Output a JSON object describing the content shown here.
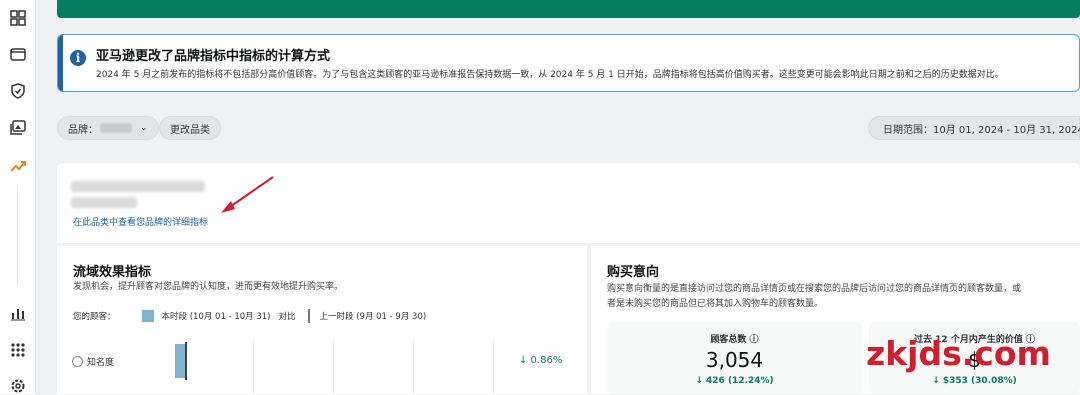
{
  "sidebar": {
    "icons": [
      "dashboard-icon",
      "wallet-icon",
      "shield-icon",
      "media-icon",
      "trend-icon",
      "bar-chart-icon",
      "apps-icon",
      "settings-icon"
    ]
  },
  "alert": {
    "title": "亚马逊更改了品牌指标中指标的计算方式",
    "text": "2024 年 5 月之前发布的指标将不包括部分高价值顾客。为了与包含这类顾客的亚马逊标准报告保持数据一致，从 2024 年 5 月 1 日开始，品牌指标将包括高价值购买者。这些变更可能会影响此日期之前和之后的历史数据对比。"
  },
  "filters": {
    "brand_label": "品牌：",
    "change_category": "更改品类",
    "date_range": "日期范围：10月 01, 2024 - 10月 31, 2024"
  },
  "brand": {
    "link": "在此品类中查看您品牌的详细指标"
  },
  "traffic": {
    "title": "流域效果指标",
    "desc": "发现机会，提升顾客对您品牌的认知度，进而更有效地提升购买率。",
    "legend_prefix": "您的顾客：",
    "current": "本时段 (10月 01 - 10月 31)",
    "compare": "对比",
    "previous": "上一时段 (9月 01 - 9月 30)",
    "row_label": "知名度",
    "row_delta": "↓ 0.86%"
  },
  "purchase": {
    "title": "购买意向",
    "desc_line1": "购买意向衡量的是直接访问过您的商品详情页或在搜索您的品牌后访问过您的商品详情页的顾客数量，或",
    "desc_line2": "者是未购买您的商品但已将其加入购物车的顾客数量。",
    "card1": {
      "label": "顾客总数 ⓘ",
      "value": "3,054",
      "delta": "↓ 426 (12.24%)"
    },
    "card2": {
      "label": "过去 12 个月内产生的价值 ⓘ",
      "value": "$",
      "delta": "↓ $353 (30.08%)"
    }
  },
  "watermark": "zkjds.com",
  "colors": {
    "accent_green": "#067d62",
    "link_blue": "#2162a1",
    "bar_blue": "#7fb3cf",
    "arrow_red": "#d11d2d"
  }
}
